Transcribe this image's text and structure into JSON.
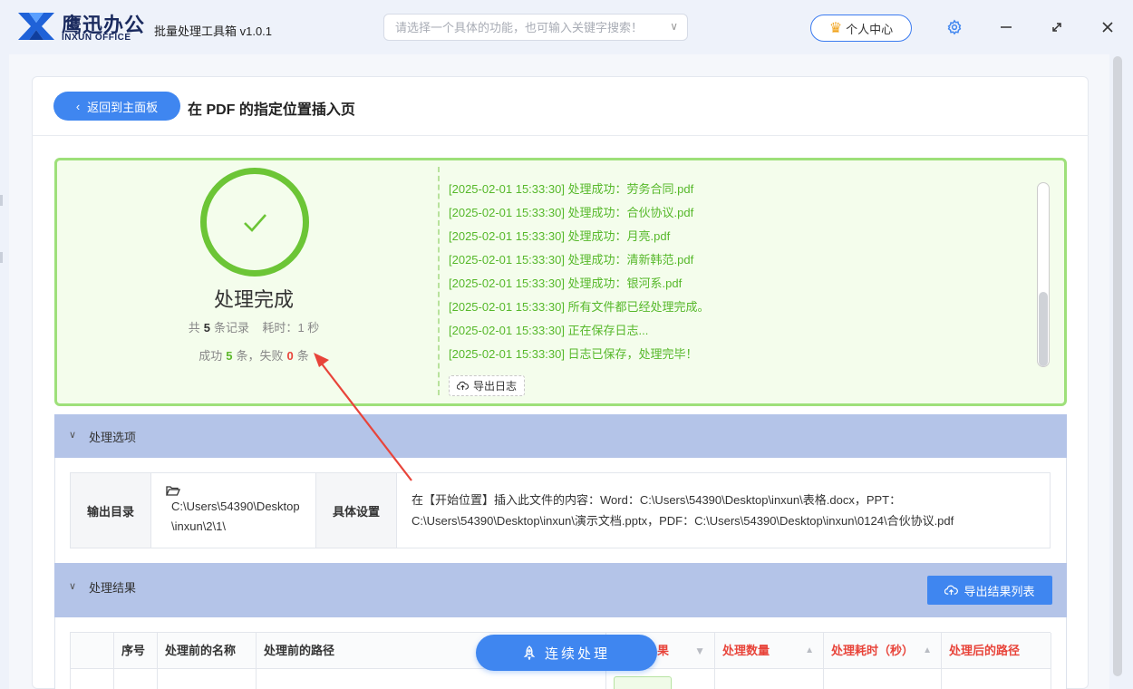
{
  "app": {
    "logo_cn": "鹰迅办公",
    "logo_en": "INXUN OFFICE",
    "title": "批量处理工具箱 v1.0.1",
    "search_placeholder": "请选择一个具体的功能，也可输入关键字搜索！",
    "user_center": "个人中心",
    "accent": "#3f86f0"
  },
  "page": {
    "back_label": "返回到主面板",
    "title": "在 PDF 的指定位置插入页"
  },
  "summary": {
    "status_title": "处理完成",
    "total_prefix": "共",
    "total_count": "5",
    "total_suffix": "条记录",
    "time_label": "耗时：",
    "time_value": "1 秒",
    "success_prefix": "成功",
    "success_count": "5",
    "success_suffix": "条，失败",
    "fail_count": "0",
    "fail_suffix": "条",
    "success_color": "#5cb82c",
    "fail_color": "#e8443a"
  },
  "log": {
    "lines": [
      "[2025-02-01 15:33:30] 处理成功：劳务合同.pdf",
      "[2025-02-01 15:33:30] 处理成功：合伙协议.pdf",
      "[2025-02-01 15:33:30] 处理成功：月亮.pdf",
      "[2025-02-01 15:33:30] 处理成功：清新韩范.pdf",
      "[2025-02-01 15:33:30] 处理成功：银河系.pdf",
      "[2025-02-01 15:33:30] 所有文件都已经处理完成。",
      "[2025-02-01 15:33:30] 正在保存日志...",
      "[2025-02-01 15:33:30] 日志已保存，处理完毕！"
    ],
    "export_label": "导出日志"
  },
  "options": {
    "section_label": "处理选项",
    "output_dir_label": "输出目录",
    "output_dir_value": "C:\\Users\\54390\\Desktop\\inxun\\2\\1\\",
    "settings_label": "具体设置",
    "settings_value": "在【开始位置】插入此文件的内容：Word：C:\\Users\\54390\\Desktop\\inxun\\表格.docx，PPT：C:\\Users\\54390\\Desktop\\inxun\\演示文档.pptx，PDF：C:\\Users\\54390\\Desktop\\inxun\\0124\\合伙协议.pdf"
  },
  "results": {
    "section_label": "处理结果",
    "export_label": "导出结果列表",
    "columns": {
      "index": "序号",
      "name_before": "处理前的名称",
      "path_before": "处理前的路径",
      "status": "果",
      "count": "处理数量",
      "duration": "处理耗时（秒）",
      "path_after": "处理后的路径"
    }
  },
  "floating": {
    "continue_label": "连续处理"
  }
}
